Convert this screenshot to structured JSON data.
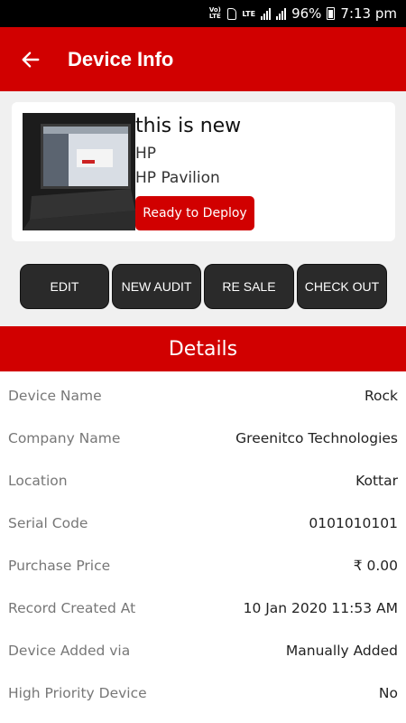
{
  "status_bar": {
    "volte": "Vo) LTE",
    "lte": "LTE",
    "battery": "96%",
    "time": "7:13 pm"
  },
  "app_bar": {
    "title": "Device Info",
    "back_icon": "arrow-left-icon"
  },
  "device_card": {
    "name": "this is new",
    "brand": "HP",
    "model": "HP Pavilion",
    "status": "Ready to Deploy"
  },
  "actions": {
    "edit": "EDIT",
    "new_audit": "NEW AUDIT",
    "re_sale": "RE SALE",
    "check_out": "CHECK OUT"
  },
  "details_header": "Details",
  "details": [
    {
      "label": "Device Name",
      "value": "Rock"
    },
    {
      "label": "Company Name",
      "value": "Greenitco Technologies"
    },
    {
      "label": "Location",
      "value": "Kottar"
    },
    {
      "label": "Serial Code",
      "value": "0101010101"
    },
    {
      "label": "Purchase Price",
      "value": "₹ 0.00"
    },
    {
      "label": "Record Created At",
      "value": "10 Jan 2020 11:53 AM"
    },
    {
      "label": "Device Added via",
      "value": "Manually Added"
    },
    {
      "label": "High Priority Device",
      "value": "No"
    }
  ],
  "colors": {
    "primary": "#d10000",
    "button_dark": "#2a2a2a"
  }
}
